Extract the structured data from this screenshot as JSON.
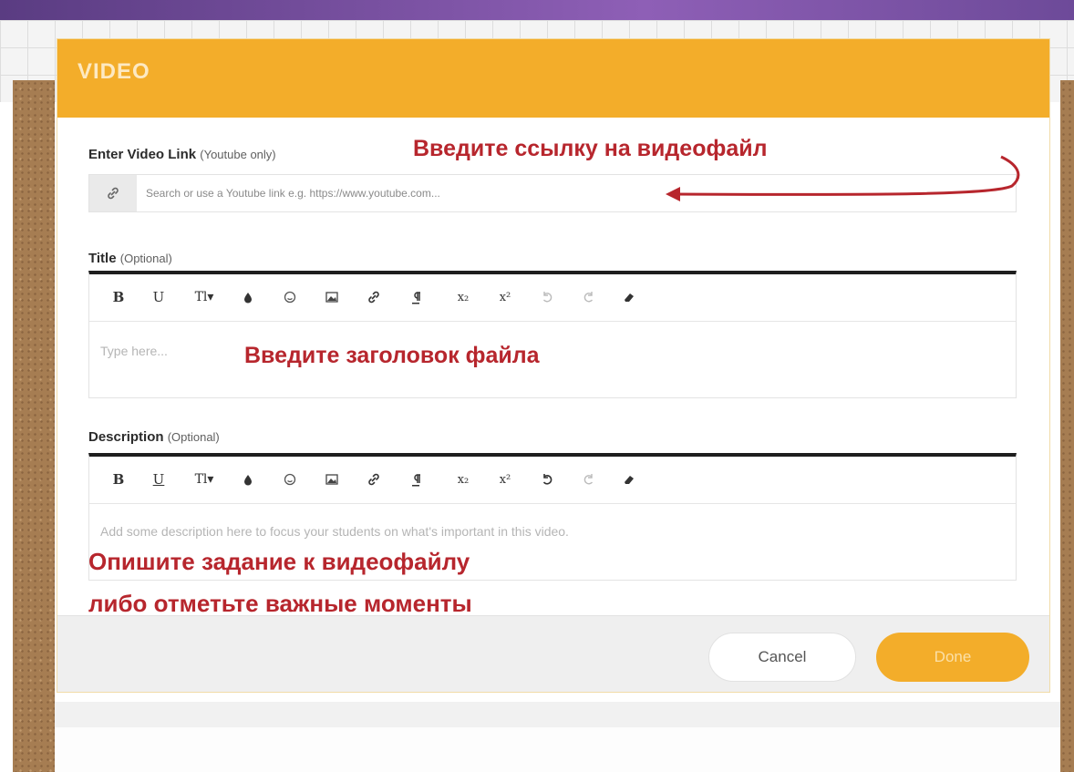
{
  "modal": {
    "title": "VIDEO",
    "link_label": "Enter Video Link",
    "link_hint": "(Youtube only)",
    "link_placeholder": "Search or use a Youtube link e.g. https://www.youtube.com...",
    "link_icon": "link-icon",
    "title_label": "Title",
    "title_optional": "(Optional)",
    "title_placeholder": "Type here...",
    "description_label": "Description",
    "description_optional": "(Optional)",
    "description_placeholder": "Add some description here to focus your students on what's important in this video.",
    "cancel_label": "Cancel",
    "done_label": "Done"
  },
  "toolbar": {
    "bold": "B",
    "underline": "U",
    "font_size": "Tl▾",
    "subscript": "x₂",
    "superscript": "x²",
    "icons": [
      "bold-icon",
      "underline-icon",
      "text-size-icon",
      "color-drop-icon",
      "emoji-icon",
      "image-icon",
      "link-icon",
      "paragraph-icon",
      "subscript-icon",
      "superscript-icon",
      "undo-icon",
      "redo-icon",
      "eraser-icon"
    ]
  },
  "annotations": {
    "link": "Введите ссылку на видеофайл",
    "title": "Введите заголовок файла",
    "description_line1": "Опишите задание к видеофайлу",
    "description_line2": "либо отметьте важные моменты"
  },
  "colors": {
    "accent": "#f3ad2a",
    "annotation": "#b7262d",
    "toolbar_border": "#1e1e1e"
  }
}
